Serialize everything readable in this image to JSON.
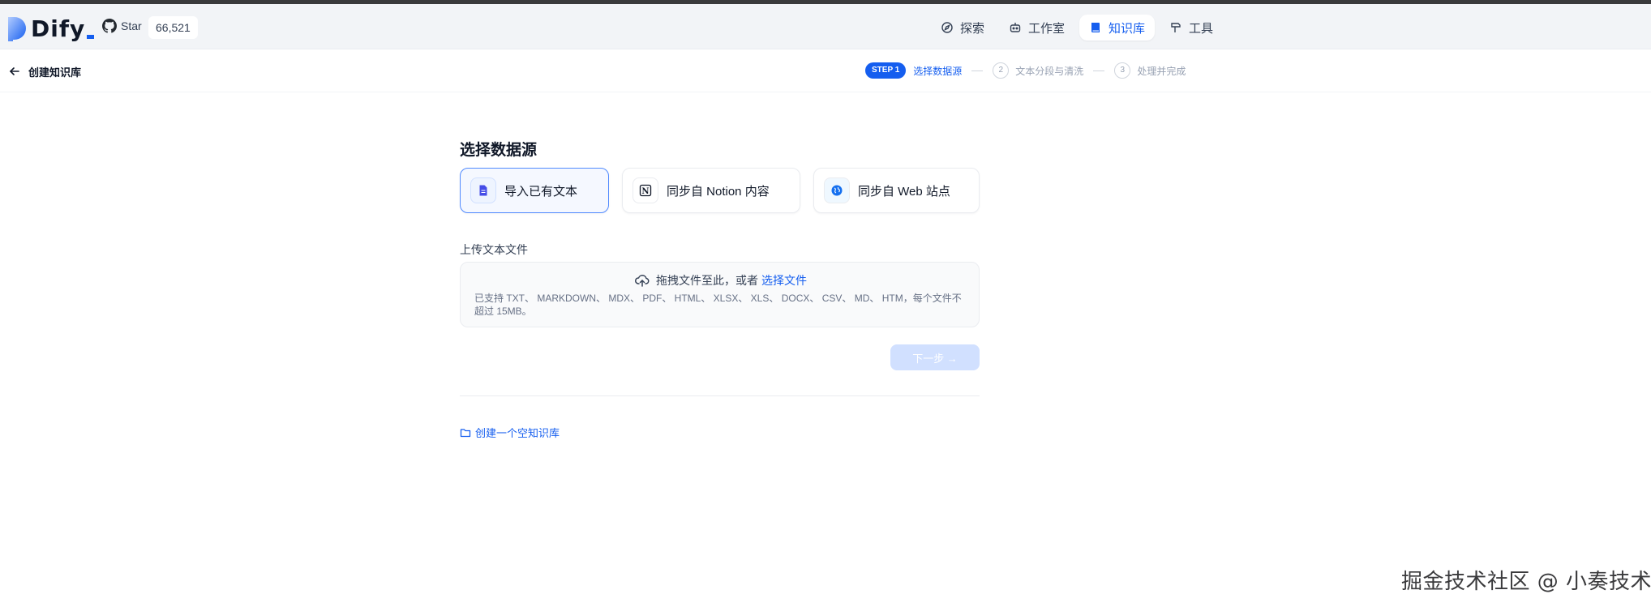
{
  "header": {
    "logo_text": "Dify",
    "github_label": "Star",
    "github_count": "66,521",
    "nav": [
      {
        "label": "探索",
        "icon": "compass-icon"
      },
      {
        "label": "工作室",
        "icon": "robot-icon"
      },
      {
        "label": "知识库",
        "icon": "book-icon",
        "active": true
      },
      {
        "label": "工具",
        "icon": "hammer-icon"
      }
    ]
  },
  "subbar": {
    "title": "创建知识库",
    "steps": {
      "step1_badge": "STEP 1",
      "step1_label": "选择数据源",
      "step2_num": "2",
      "step2_label": "文本分段与清洗",
      "step3_num": "3",
      "step3_label": "处理并完成"
    }
  },
  "main": {
    "section_title": "选择数据源",
    "sources": [
      {
        "label": "导入已有文本",
        "icon": "file-text-icon",
        "active": true
      },
      {
        "label": "同步自 Notion 内容",
        "icon": "notion-icon"
      },
      {
        "label": "同步自 Web 站点",
        "icon": "globe-icon"
      }
    ],
    "upload_label": "上传文本文件",
    "dropzone": {
      "text": "拖拽文件至此，或者",
      "link": "选择文件",
      "hint": "已支持 TXT、 MARKDOWN、 MDX、 PDF、 HTML、 XLSX、 XLS、 DOCX、 CSV、 MD、 HTM，每个文件不超过 15MB。"
    },
    "next_button": "下一步 →",
    "empty_link": "创建一个空知识库"
  },
  "watermark": "掘金技术社区 @ 小奏技术",
  "colors": {
    "accent": "#155eef",
    "header_bg": "#f2f4f7",
    "disabled_button": "#d1e0ff"
  }
}
